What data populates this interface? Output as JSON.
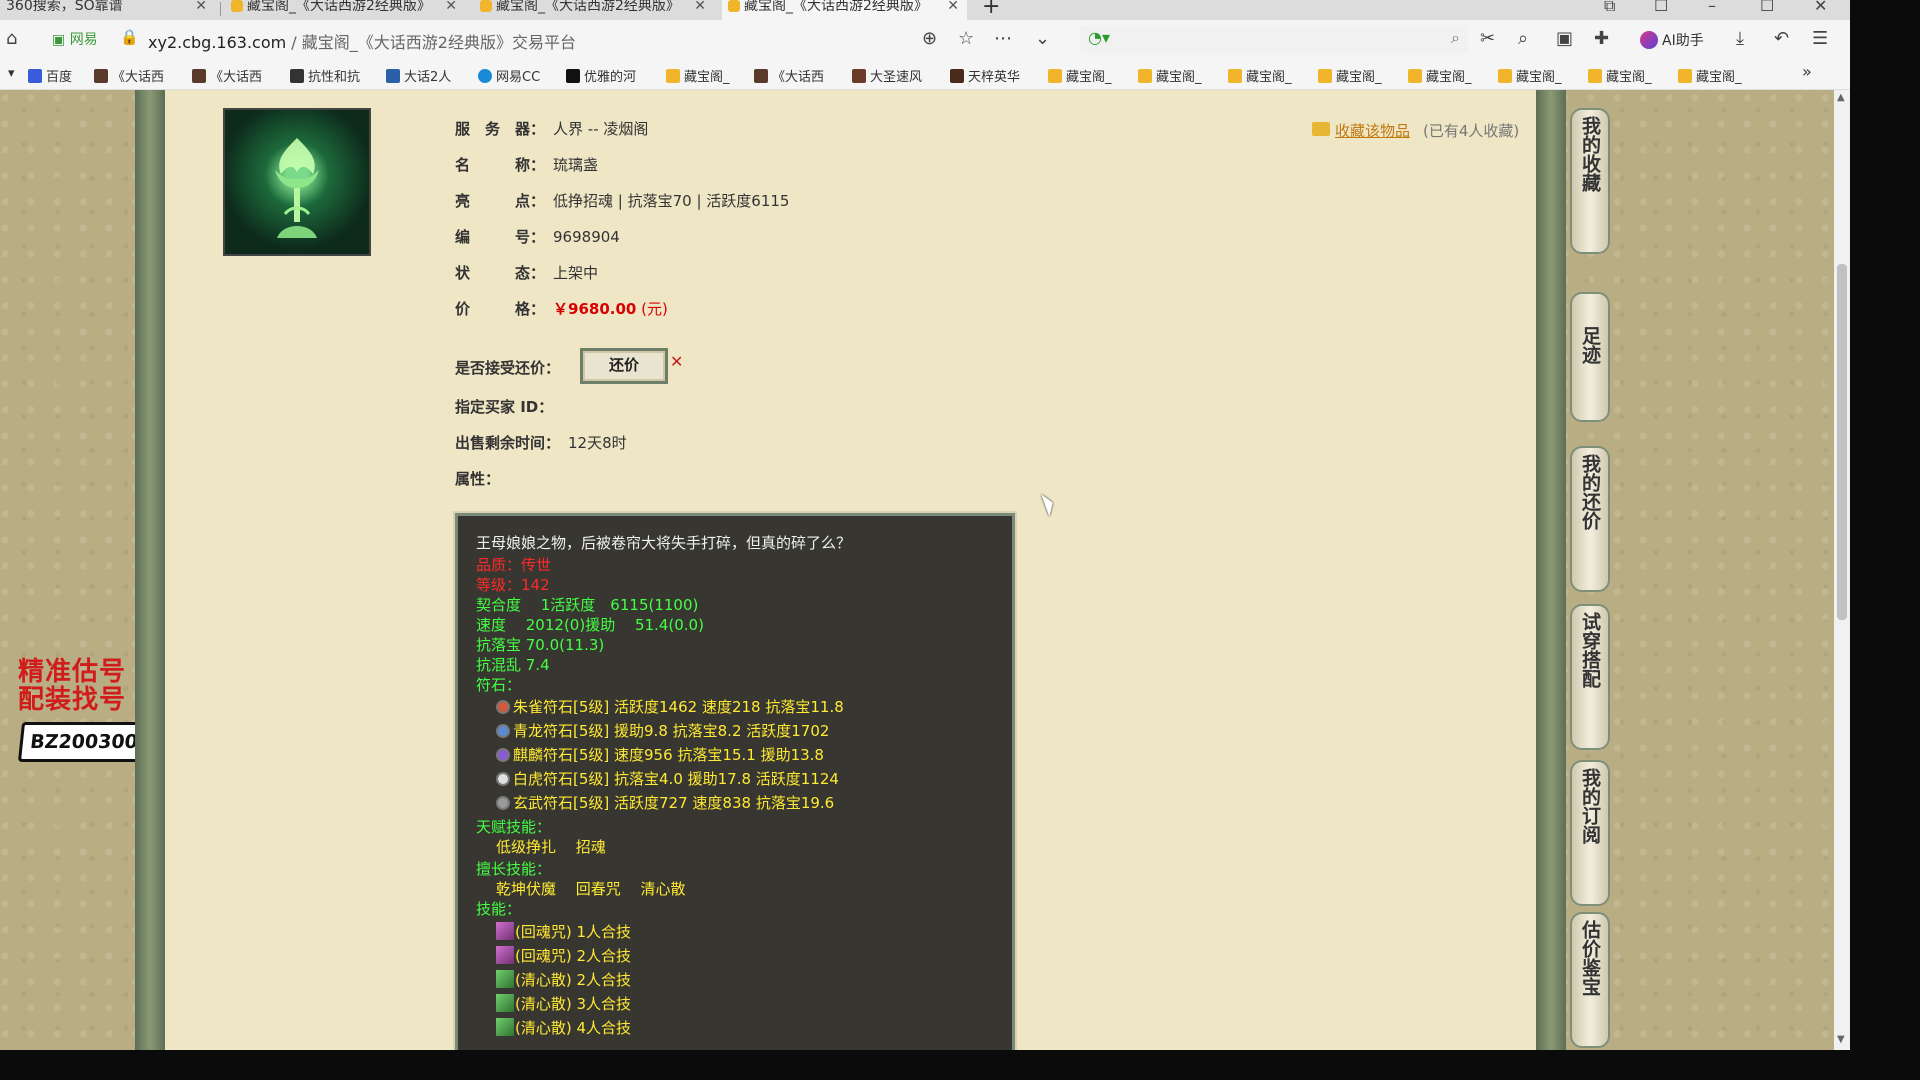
{
  "browser": {
    "tabs": [
      {
        "title": "360搜索，SO靠谱",
        "active": false
      },
      {
        "title": "藏宝阁_《大话西游2经典版》",
        "active": false
      },
      {
        "title": "藏宝阁_《大话西游2经典版》",
        "active": false
      },
      {
        "title": "藏宝阁_《大话西游2经典版》",
        "active": true
      }
    ],
    "url_badge": "网易",
    "url_domain": "xy2.cbg.163.com",
    "url_title": " / 藏宝阁_《大话西游2经典版》交易平台",
    "search_placeholder": "",
    "ai_helper_label": "AI助手",
    "bookmarks": [
      "百度",
      "《大话西",
      "《大话西",
      "抗性和抗",
      "大话2人",
      "网易CC",
      "优雅的河",
      "藏宝阁_",
      "《大话西",
      "大圣速风",
      "天梓英华",
      "藏宝阁_",
      "藏宝阁_",
      "藏宝阁_",
      "藏宝阁_",
      "藏宝阁_",
      "藏宝阁_",
      "藏宝阁_",
      "藏宝阁_"
    ]
  },
  "item": {
    "fields": [
      {
        "label": "服　务　器：",
        "value": "人界 -- 凌烟阁"
      },
      {
        "label": "名　　　称：",
        "value": "琉璃盏"
      },
      {
        "label": "亮　　　点：",
        "value": "低挣招魂 | 抗落宝70 | 活跃度6115"
      },
      {
        "label": "编　　　号：",
        "value": "9698904"
      },
      {
        "label": "状　　　态：",
        "value": "上架中"
      }
    ],
    "price_label": "价　　　格：",
    "price_value": "￥9680.00",
    "price_unit": "(元)",
    "bargain_label": "是否接受还价：",
    "bargain_button": "还价",
    "buyer_id_label": "指定买家 ID：",
    "remaining_label": "出售剩余时间：",
    "remaining_value": "12天8时",
    "attr_label": "属性：",
    "favorite_link": "收藏该物品",
    "favorite_count": "(已有4人收藏)"
  },
  "attributes": {
    "desc": "王母娘娘之物，后被卷帘大将失手打碎，但真的碎了么？",
    "quality": "品质：传世",
    "level": "等级：142",
    "line1": "契合度　 1活跃度　6115(1100)",
    "line2": "速度　  2012(0)援助　  51.4(0.0)",
    "line3": "抗落宝  70.0(11.3)",
    "line4": "抗混乱  7.4",
    "runes_label": "符石：",
    "runes": [
      "朱雀符石[5级] 活跃度1462 速度218 抗落宝11.8",
      "青龙符石[5级] 援助9.8 抗落宝8.2 活跃度1702",
      "麒麟符石[5级] 速度956 抗落宝15.1 援助13.8",
      "白虎符石[5级] 抗落宝4.0 援助17.8 活跃度1124",
      "玄武符石[5级] 活跃度727 速度838 抗落宝19.6"
    ],
    "talent_label": "天赋技能：",
    "talent_skills": "低级挣扎　 招魂",
    "expert_label": "擅长技能：",
    "expert_skills": "乾坤伏魔　 回春咒　 清心散",
    "skills_label": "技能：",
    "skills": [
      "(回魂咒) 1人合技",
      "(回魂咒) 2人合技",
      "(清心散) 2人合技",
      "(清心散) 3人合技",
      "(清心散) 4人合技"
    ]
  },
  "side_tabs": [
    "我的收藏",
    "足迹",
    "我的还价",
    "试穿搭配",
    "我的订阅",
    "估价鉴宝"
  ],
  "ad": {
    "line1": "精准估号",
    "line2": "配装找号",
    "code": "BZ200300"
  },
  "colors": {
    "price": "#d80000",
    "panel_bg": "#373630",
    "page_bg": "#efe6c6"
  }
}
